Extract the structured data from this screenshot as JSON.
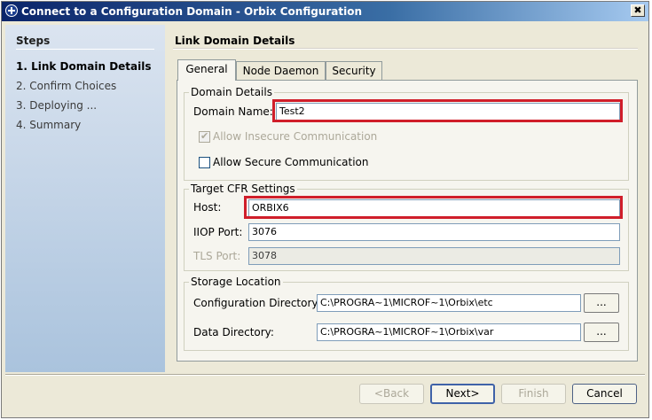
{
  "window": {
    "title": "Connect to a Configuration Domain - Orbix Configuration",
    "close_label": "✖"
  },
  "steps": {
    "heading": "Steps",
    "items": [
      "1. Link Domain Details",
      "2. Confirm Choices",
      "3. Deploying ...",
      "4. Summary"
    ],
    "active_index": 0
  },
  "page": {
    "title": "Link Domain Details"
  },
  "tabs": [
    "General",
    "Node Daemon",
    "Security"
  ],
  "domain_details": {
    "legend": "Domain Details",
    "name_label": "Domain Name:",
    "name_value": "Test2",
    "allow_insecure_label": "Allow Insecure Communication",
    "allow_insecure_checked": true,
    "allow_insecure_disabled": true,
    "allow_secure_label": "Allow Secure Communication",
    "allow_secure_checked": false
  },
  "target_cfr": {
    "legend": "Target CFR Settings",
    "host_label": "Host:",
    "host_value": "ORBIX6",
    "iiop_label": "IIOP Port:",
    "iiop_value": "3076",
    "tls_label": "TLS Port:",
    "tls_value": "3078"
  },
  "storage": {
    "legend": "Storage Location",
    "config_dir_label": "Configuration Directory:",
    "config_dir_value": "C:\\PROGRA~1\\MICROF~1\\Orbix\\etc",
    "data_dir_label": "Data Directory:",
    "data_dir_value": "C:\\PROGRA~1\\MICROF~1\\Orbix\\var",
    "browse_label": "..."
  },
  "buttons": {
    "back": "<Back",
    "next": "Next>",
    "finish": "Finish",
    "cancel": "Cancel"
  },
  "colors": {
    "highlight": "#d01e2a",
    "title_bar": "#0a246a",
    "steps_panel": "#aac3dd"
  }
}
